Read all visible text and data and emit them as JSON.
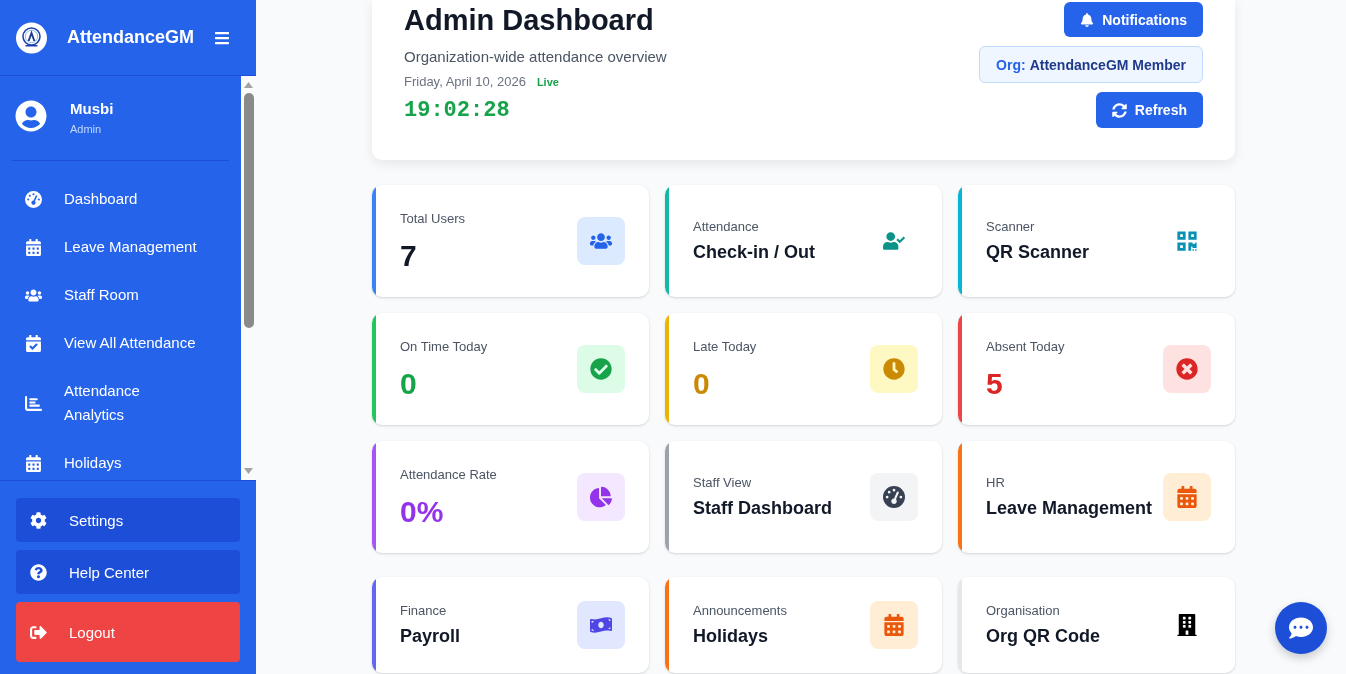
{
  "sidebar": {
    "brand": "AttendanceGM",
    "user": {
      "name": "Musbi",
      "role": "Admin"
    },
    "nav": [
      {
        "label": "Dashboard"
      },
      {
        "label": "Leave Management"
      },
      {
        "label": "Staff Room"
      },
      {
        "label": "View All Attendance"
      },
      {
        "label": "Attendance Analytics"
      },
      {
        "label": "Holidays"
      }
    ],
    "actions": [
      {
        "kind": "settings",
        "label": "Settings"
      },
      {
        "kind": "help",
        "label": "Help Center"
      },
      {
        "kind": "logout",
        "label": "Logout"
      }
    ]
  },
  "header": {
    "title": "Admin Dashboard",
    "subtitle": "Organization-wide attendance overview",
    "date": "Friday, April 10, 2026",
    "live": "Live",
    "clock": "19:02:28",
    "notifications": "Notifications",
    "org": {
      "label": "Org:",
      "name": "AttendanceGM Member"
    },
    "refresh": "Refresh"
  },
  "cards": [
    {
      "kind": "stat",
      "label": "Total Users",
      "value": {
        "text": "7",
        "color": "#111827"
      },
      "color": "#3b82f6",
      "icon": {
        "color": "#2563eb",
        "tile": {
          "color": "#dbeafe"
        }
      }
    },
    {
      "kind": "link",
      "label": "Attendance",
      "value": {
        "text": "Check-in / Out"
      },
      "color": "#14b8a6",
      "icon": {
        "color": "#0d9488"
      }
    },
    {
      "kind": "link",
      "label": "Scanner",
      "value": {
        "text": "QR Scanner"
      },
      "color": "#06b6d4",
      "icon": {
        "color": "#0891b2"
      }
    },
    {
      "kind": "stat",
      "label": "On Time Today",
      "value": {
        "text": "0",
        "color": "#16a34a"
      },
      "color": "#22c55e",
      "icon": {
        "color": "#16a34a",
        "tile": {
          "color": "#dcfce7"
        }
      }
    },
    {
      "kind": "stat",
      "label": "Late Today",
      "value": {
        "text": "0",
        "color": "#ca8a04"
      },
      "color": "#eab308",
      "icon": {
        "color": "#ca8a04",
        "tile": {
          "color": "#fef9c3"
        }
      }
    },
    {
      "kind": "stat",
      "label": "Absent Today",
      "value": {
        "text": "5",
        "color": "#dc2626"
      },
      "color": "#ef4444",
      "icon": {
        "color": "#dc2626",
        "tile": {
          "color": "#fee2e2"
        }
      }
    },
    {
      "kind": "stat",
      "label": "Attendance Rate",
      "value": {
        "text": "0%",
        "color": "#9333ea"
      },
      "color": "#a855f7",
      "icon": {
        "color": "#9333ea",
        "tile": {
          "color": "#f3e8ff"
        }
      }
    },
    {
      "kind": "link",
      "label": "Staff View",
      "value": {
        "text": "Staff Dashboard"
      },
      "color": "#9ca3af",
      "icon": {
        "color": "#374151",
        "tile": {
          "color": "#f3f4f6"
        }
      }
    },
    {
      "kind": "link",
      "label": "HR",
      "value": {
        "text": "Leave Management"
      },
      "color": "#f97316",
      "icon": {
        "color": "#ea580c",
        "tile": {
          "color": "#ffedd5"
        }
      }
    }
  ],
  "shortcuts": [
    {
      "kind": "link",
      "label": "Finance",
      "value": {
        "text": "Payroll"
      },
      "color": "#6366f1",
      "icon": {
        "color": "#4f46e5",
        "tile": {
          "color": "#e0e7ff"
        }
      }
    },
    {
      "kind": "link",
      "label": "Announcements",
      "value": {
        "text": "Holidays"
      },
      "color": "#f97316",
      "icon": {
        "color": "#ea580c",
        "tile": {
          "color": "#ffedd5"
        }
      }
    },
    {
      "kind": "link",
      "label": "Organisation",
      "value": {
        "text": "Org QR Code"
      },
      "color": "#e5e7eb",
      "icon": {
        "color": "#000000"
      }
    }
  ]
}
